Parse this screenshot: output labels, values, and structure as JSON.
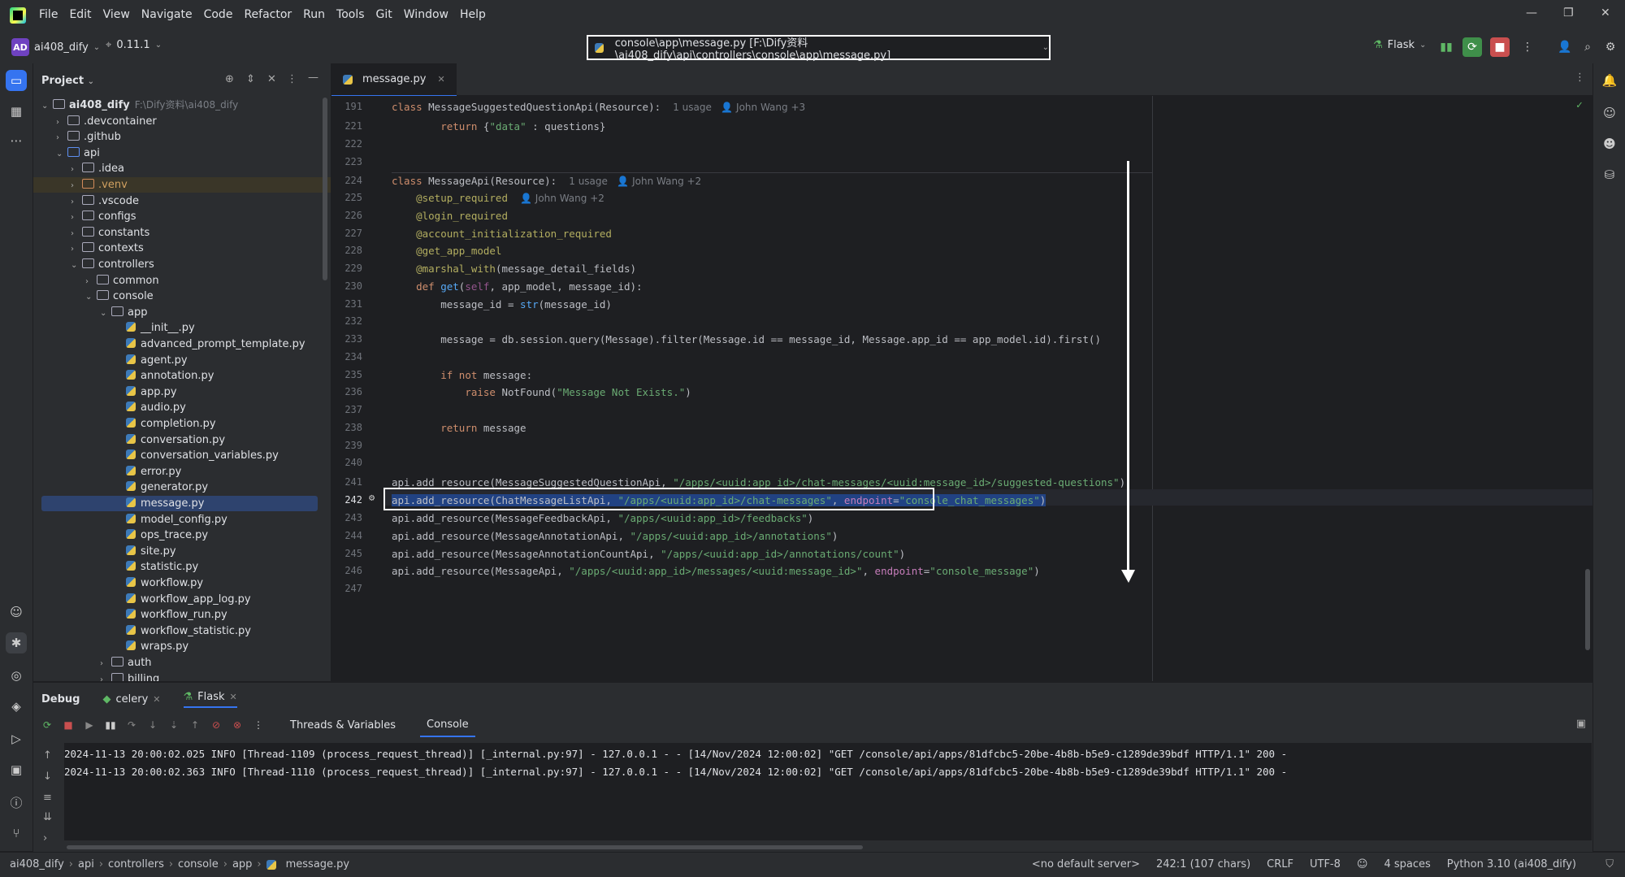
{
  "menu": [
    "File",
    "Edit",
    "View",
    "Navigate",
    "Code",
    "Refactor",
    "Run",
    "Tools",
    "Git",
    "Window",
    "Help"
  ],
  "window_controls": {
    "minimize": "—",
    "restore": "❐",
    "close": "✕"
  },
  "toolbar": {
    "project_initials": "AD",
    "project_name": "ai408_dify",
    "branch_version": "0.11.1",
    "file_path": "console\\app\\message.py [F:\\Dify资料\\ai408_dify\\api\\controllers\\console\\app\\message.py]",
    "run_config": "Flask"
  },
  "project_panel": {
    "title": "Project",
    "tree": [
      {
        "label": "ai408_dify",
        "hint": "F:\\Dify资料\\ai408_dify",
        "depth": 0,
        "type": "folder",
        "expanded": true,
        "bold": true
      },
      {
        "label": ".devcontainer",
        "depth": 1,
        "type": "folder"
      },
      {
        "label": ".github",
        "depth": 1,
        "type": "folder"
      },
      {
        "label": "api",
        "depth": 1,
        "type": "folder-blue",
        "expanded": true
      },
      {
        "label": ".idea",
        "depth": 2,
        "type": "folder"
      },
      {
        "label": ".venv",
        "depth": 2,
        "type": "folder-orange",
        "highlight": true
      },
      {
        "label": ".vscode",
        "depth": 2,
        "type": "folder"
      },
      {
        "label": "configs",
        "depth": 2,
        "type": "folder"
      },
      {
        "label": "constants",
        "depth": 2,
        "type": "folder"
      },
      {
        "label": "contexts",
        "depth": 2,
        "type": "folder"
      },
      {
        "label": "controllers",
        "depth": 2,
        "type": "folder",
        "expanded": true
      },
      {
        "label": "common",
        "depth": 3,
        "type": "folder"
      },
      {
        "label": "console",
        "depth": 3,
        "type": "folder",
        "expanded": true
      },
      {
        "label": "app",
        "depth": 4,
        "type": "folder",
        "expanded": true
      },
      {
        "label": "__init__.py",
        "depth": 5,
        "type": "py"
      },
      {
        "label": "advanced_prompt_template.py",
        "depth": 5,
        "type": "py"
      },
      {
        "label": "agent.py",
        "depth": 5,
        "type": "py"
      },
      {
        "label": "annotation.py",
        "depth": 5,
        "type": "py"
      },
      {
        "label": "app.py",
        "depth": 5,
        "type": "py"
      },
      {
        "label": "audio.py",
        "depth": 5,
        "type": "py"
      },
      {
        "label": "completion.py",
        "depth": 5,
        "type": "py"
      },
      {
        "label": "conversation.py",
        "depth": 5,
        "type": "py"
      },
      {
        "label": "conversation_variables.py",
        "depth": 5,
        "type": "py"
      },
      {
        "label": "error.py",
        "depth": 5,
        "type": "py"
      },
      {
        "label": "generator.py",
        "depth": 5,
        "type": "py"
      },
      {
        "label": "message.py",
        "depth": 5,
        "type": "py",
        "selected": true
      },
      {
        "label": "model_config.py",
        "depth": 5,
        "type": "py"
      },
      {
        "label": "ops_trace.py",
        "depth": 5,
        "type": "py"
      },
      {
        "label": "site.py",
        "depth": 5,
        "type": "py"
      },
      {
        "label": "statistic.py",
        "depth": 5,
        "type": "py"
      },
      {
        "label": "workflow.py",
        "depth": 5,
        "type": "py"
      },
      {
        "label": "workflow_app_log.py",
        "depth": 5,
        "type": "py"
      },
      {
        "label": "workflow_run.py",
        "depth": 5,
        "type": "py"
      },
      {
        "label": "workflow_statistic.py",
        "depth": 5,
        "type": "py"
      },
      {
        "label": "wraps.py",
        "depth": 5,
        "type": "py"
      },
      {
        "label": "auth",
        "depth": 4,
        "type": "folder"
      },
      {
        "label": "billing",
        "depth": 4,
        "type": "folder"
      }
    ]
  },
  "editor": {
    "tab_label": "message.py",
    "lines": [
      {
        "n": "191",
        "segs": [
          [
            "kw",
            "class "
          ],
          [
            "",
            "MessageSuggestedQuestionApi(Resource):  "
          ],
          [
            "hint",
            "1 usage   👤 John Wang +3"
          ]
        ]
      },
      {
        "n": "221",
        "segs": [
          [
            "",
            "        "
          ],
          [
            "kw",
            "return "
          ],
          [
            "",
            "{"
          ],
          [
            "str",
            "\"data\""
          ],
          [
            "",
            " : questions}"
          ]
        ]
      },
      {
        "n": "222",
        "segs": []
      },
      {
        "n": "223",
        "segs": []
      },
      {
        "n": "224",
        "segs": [
          [
            "kw",
            "class "
          ],
          [
            "",
            "MessageApi(Resource):  "
          ],
          [
            "hint",
            "1 usage   👤 John Wang +2"
          ]
        ]
      },
      {
        "n": "225",
        "segs": [
          [
            "dec",
            "    @setup_required  "
          ],
          [
            "hint",
            "👤 John Wang +2"
          ]
        ]
      },
      {
        "n": "226",
        "segs": [
          [
            "dec",
            "    @login_required"
          ]
        ]
      },
      {
        "n": "227",
        "segs": [
          [
            "dec",
            "    @account_initialization_required"
          ]
        ]
      },
      {
        "n": "228",
        "segs": [
          [
            "dec",
            "    @get_app_model"
          ]
        ]
      },
      {
        "n": "229",
        "segs": [
          [
            "dec",
            "    @marshal_with"
          ],
          [
            "",
            "(message_detail_fields)"
          ]
        ]
      },
      {
        "n": "230",
        "segs": [
          [
            "",
            "    "
          ],
          [
            "kw",
            "def "
          ],
          [
            "fn",
            "get"
          ],
          [
            "",
            "("
          ],
          [
            "self",
            "self"
          ],
          [
            "",
            ", app_model, message_id):"
          ]
        ]
      },
      {
        "n": "231",
        "segs": [
          [
            "",
            "        message_id = "
          ],
          [
            "fn",
            "str"
          ],
          [
            "",
            "(message_id)"
          ]
        ]
      },
      {
        "n": "232",
        "segs": []
      },
      {
        "n": "233",
        "segs": [
          [
            "",
            "        message = db.session.query(Message).filter(Message.id == message_id, Message.app_id == app_model.id).first()"
          ]
        ]
      },
      {
        "n": "234",
        "segs": []
      },
      {
        "n": "235",
        "segs": [
          [
            "",
            "        "
          ],
          [
            "kw",
            "if not "
          ],
          [
            "",
            "message:"
          ]
        ]
      },
      {
        "n": "236",
        "segs": [
          [
            "",
            "            "
          ],
          [
            "kw",
            "raise "
          ],
          [
            "",
            "NotFound("
          ],
          [
            "str",
            "\"Message Not Exists.\""
          ],
          [
            "",
            ")"
          ]
        ]
      },
      {
        "n": "237",
        "segs": []
      },
      {
        "n": "238",
        "segs": [
          [
            "",
            "        "
          ],
          [
            "kw",
            "return "
          ],
          [
            "",
            "message"
          ]
        ]
      },
      {
        "n": "239",
        "segs": []
      },
      {
        "n": "240",
        "segs": []
      },
      {
        "n": "241",
        "segs": [
          [
            "",
            "api.add_resource(MessageSuggestedQuestionApi, "
          ],
          [
            "str",
            "\"/apps/<uuid:app_id>/chat-messages/<uuid:message_id>/suggested-questions\""
          ],
          [
            "",
            ")"
          ]
        ]
      },
      {
        "n": "242",
        "segs": [
          [
            "",
            "api.add_resource(ChatMessageListApi, "
          ],
          [
            "str",
            "\"/apps/<uuid:app_id>/chat-messages\""
          ],
          [
            "",
            ", "
          ],
          [
            "prm",
            "endpoint"
          ],
          [
            "",
            "="
          ],
          [
            "str",
            "\"console_chat_messages\""
          ],
          [
            "",
            ")"
          ]
        ],
        "selected": true
      },
      {
        "n": "243",
        "segs": [
          [
            "",
            "api.add_resource(MessageFeedbackApi, "
          ],
          [
            "str",
            "\"/apps/<uuid:app_id>/feedbacks\""
          ],
          [
            "",
            ")"
          ]
        ]
      },
      {
        "n": "244",
        "segs": [
          [
            "",
            "api.add_resource(MessageAnnotationApi, "
          ],
          [
            "str",
            "\"/apps/<uuid:app_id>/annotations\""
          ],
          [
            "",
            ")"
          ]
        ]
      },
      {
        "n": "245",
        "segs": [
          [
            "",
            "api.add_resource(MessageAnnotationCountApi, "
          ],
          [
            "str",
            "\"/apps/<uuid:app_id>/annotations/count\""
          ],
          [
            "",
            ")"
          ]
        ]
      },
      {
        "n": "246",
        "segs": [
          [
            "",
            "api.add_resource(MessageApi, "
          ],
          [
            "str",
            "\"/apps/<uuid:app_id>/messages/<uuid:message_id>\""
          ],
          [
            "",
            ", "
          ],
          [
            "prm",
            "endpoint"
          ],
          [
            "",
            "="
          ],
          [
            "str",
            "\"console_message\""
          ],
          [
            "",
            ")"
          ]
        ]
      },
      {
        "n": "247",
        "segs": []
      }
    ]
  },
  "debug": {
    "title": "Debug",
    "sessions": [
      "celery",
      "Flask"
    ],
    "subtabs": [
      "Threads & Variables",
      "Console"
    ],
    "active_subtab": "Console",
    "log_lines": [
      "2024-11-13 20:00:02.025 INFO [Thread-1109 (process_request_thread)] [_internal.py:97] - 127.0.0.1 - - [14/Nov/2024 12:00:02] \"GET /console/api/apps/81dfcbc5-20be-4b8b-b5e9-c1289de39bdf HTTP/1.1\" 200 -",
      "2024-11-13 20:00:02.363 INFO [Thread-1110 (process_request_thread)] [_internal.py:97] - 127.0.0.1 - - [14/Nov/2024 12:00:02] \"GET /console/api/apps/81dfcbc5-20be-4b8b-b5e9-c1289de39bdf HTTP/1.1\" 200 -"
    ]
  },
  "statusbar": {
    "breadcrumb": [
      "ai408_dify",
      "api",
      "controllers",
      "console",
      "app",
      "message.py"
    ],
    "server": "<no default server>",
    "position": "242:1 (107 chars)",
    "line_sep": "CRLF",
    "encoding": "UTF-8",
    "indent": "4 spaces",
    "interpreter": "Python 3.10 (ai408_dify)"
  },
  "colors": {
    "accent": "#3574f0",
    "selection": "#2e436e"
  }
}
